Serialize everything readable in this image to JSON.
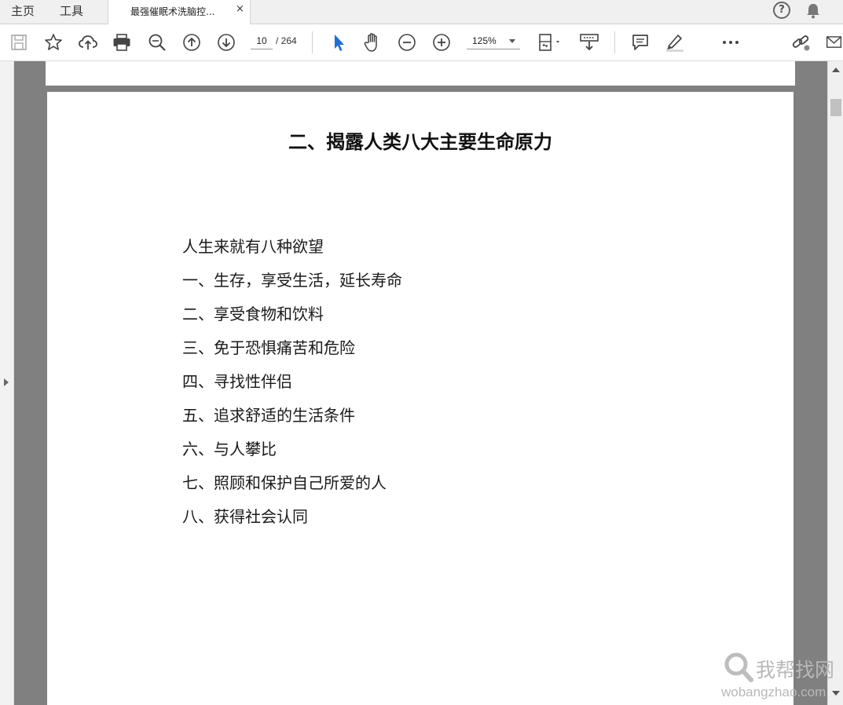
{
  "tabs": {
    "home": "主页",
    "tools": "工具",
    "document": "最强催眠术洗脑控...",
    "close": "×"
  },
  "help": "?",
  "toolbar": {
    "page_current": "10",
    "page_total": "/ 264",
    "zoom": "125%"
  },
  "page": {
    "heading": "二、揭露人类八大主要生命原力",
    "lines": [
      "人生来就有八种欲望",
      "一、生存，享受生活，延长寿命",
      "二、享受食物和饮料",
      "三、免于恐惧痛苦和危险",
      "四、寻找性伴侣",
      "五、追求舒适的生活条件",
      "六、与人攀比",
      "七、照顾和保护自己所爱的人",
      "八、获得社会认同"
    ]
  },
  "watermark": {
    "name": "我帮找网",
    "url": "wobangzhao.com"
  }
}
